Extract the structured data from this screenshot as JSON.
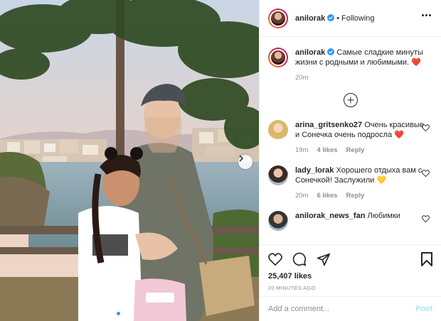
{
  "header": {
    "username": "anilorak",
    "separator": "•",
    "follow_status": "Following"
  },
  "caption": {
    "username": "anilorak",
    "text": "Самые сладкие минуты жизни с родными и любимыми.",
    "emoji": "❤️",
    "time": "20m"
  },
  "comments": [
    {
      "username": "arina_gritsenko27",
      "text": "Очень красивые и Сонечка очень подросла",
      "emoji": "❤️",
      "time": "19m",
      "likes": "4 likes",
      "reply": "Reply"
    },
    {
      "username": "lady_lorak",
      "text": "Хорошего отдыха вам с Сонечкой! Заслужили",
      "emoji": "💛",
      "time": "20m",
      "likes": "6 likes",
      "reply": "Reply"
    },
    {
      "username": "anilorak_news_fan",
      "text": "Любимки"
    }
  ],
  "actions": {
    "likes": "25,407 likes",
    "timestamp": "20 MINUTES AGO"
  },
  "add_comment": {
    "placeholder": "Add a comment...",
    "post_label": "Post"
  },
  "colors": {
    "accent": "#3897f0",
    "post_disabled": "#b2dffc",
    "heart_red": "#ed4956",
    "muted": "#8e8e8e"
  },
  "carousel": {
    "slides": 3,
    "active_slide": 1
  }
}
